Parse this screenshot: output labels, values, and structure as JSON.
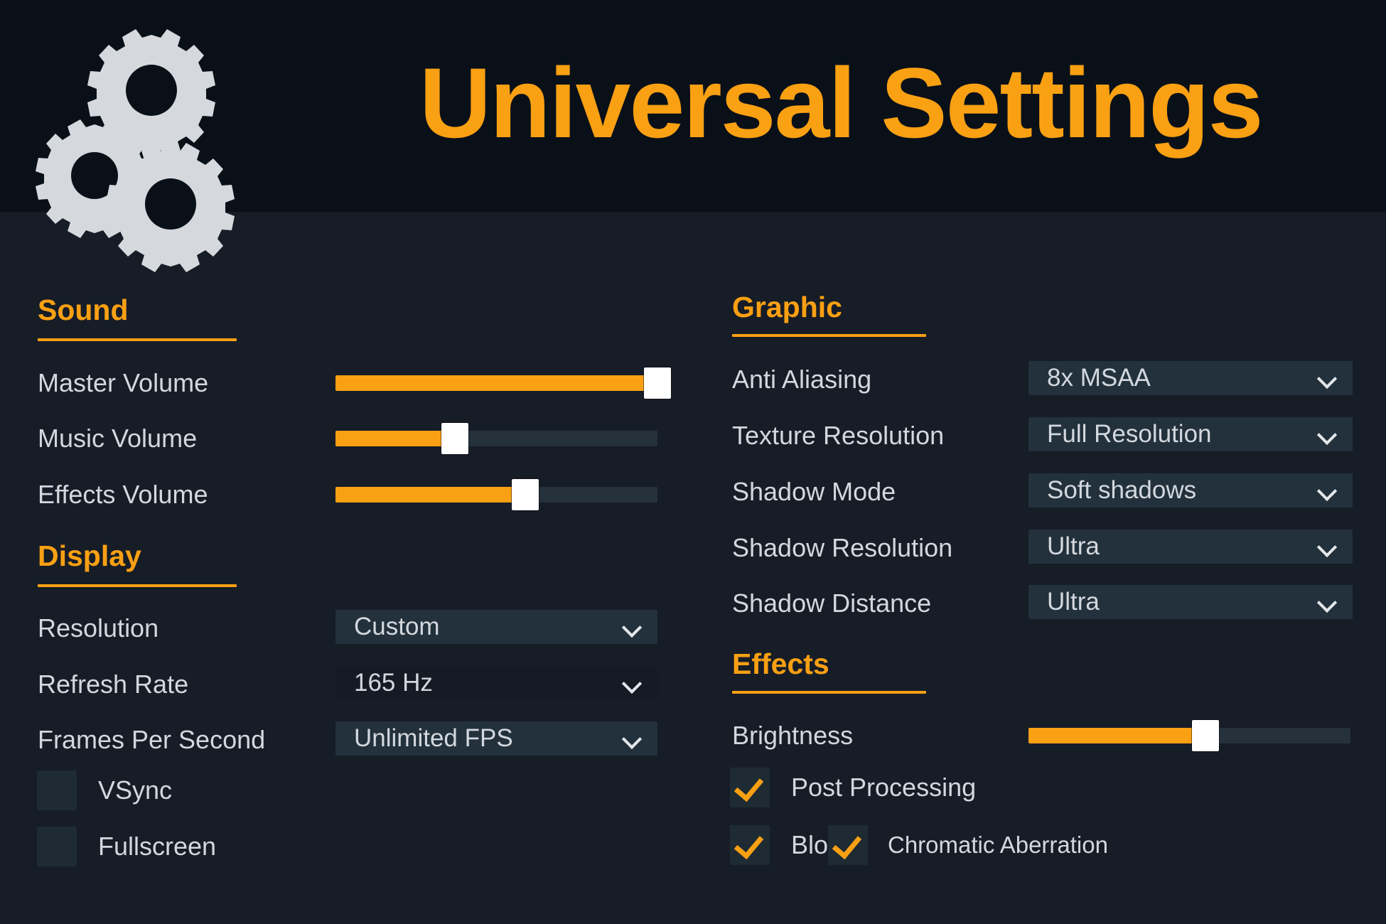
{
  "header": {
    "title": "Universal Settings",
    "logo_icon": "gears-icon",
    "background_color": "#0a1018",
    "title_color": "#f9a013"
  },
  "theme": {
    "accent": "#f9a013",
    "body_background": "#171d27",
    "label_color": "#d3d8de",
    "control_background": "#22313c",
    "slider_track": "#25313b",
    "slider_handle": "#ffffff"
  },
  "sections": {
    "sound": {
      "title": "Sound",
      "sliders": [
        {
          "label": "Master Volume",
          "value": 100
        },
        {
          "label": "Music Volume",
          "value": 37
        },
        {
          "label": "Effects Volume",
          "value": 59
        }
      ]
    },
    "display": {
      "title": "Display",
      "dropdowns": [
        {
          "label": "Resolution",
          "value": "Custom",
          "chevron": "chevron-down-icon"
        },
        {
          "label": "Refresh Rate",
          "value": "165 Hz",
          "chevron": "chevron-down-icon"
        },
        {
          "label": "Frames Per Second",
          "value": "Unlimited FPS",
          "chevron": "chevron-down-icon"
        }
      ],
      "checkboxes": [
        {
          "label": "VSync",
          "checked": false
        },
        {
          "label": "Fullscreen",
          "checked": false
        }
      ]
    },
    "graphic": {
      "title": "Graphic",
      "dropdowns": [
        {
          "label": "Anti Aliasing",
          "value": "8x MSAA",
          "chevron": "chevron-down-icon"
        },
        {
          "label": "Texture Resolution",
          "value": "Full Resolution",
          "chevron": "chevron-down-icon"
        },
        {
          "label": "Shadow Mode",
          "value": "Soft shadows",
          "chevron": "chevron-down-icon"
        },
        {
          "label": "Shadow Resolution",
          "value": "Ultra",
          "chevron": "chevron-down-icon"
        },
        {
          "label": "Shadow Distance",
          "value": "Ultra",
          "chevron": "chevron-down-icon"
        }
      ]
    },
    "effects": {
      "title": "Effects",
      "sliders": [
        {
          "label": "Brightness",
          "value": 55
        }
      ],
      "checkboxes": [
        {
          "label": "Post Processing",
          "checked": true
        },
        {
          "label": "Bloom",
          "checked": true
        },
        {
          "label": "Chromatic Aberration",
          "checked": true
        }
      ]
    }
  }
}
